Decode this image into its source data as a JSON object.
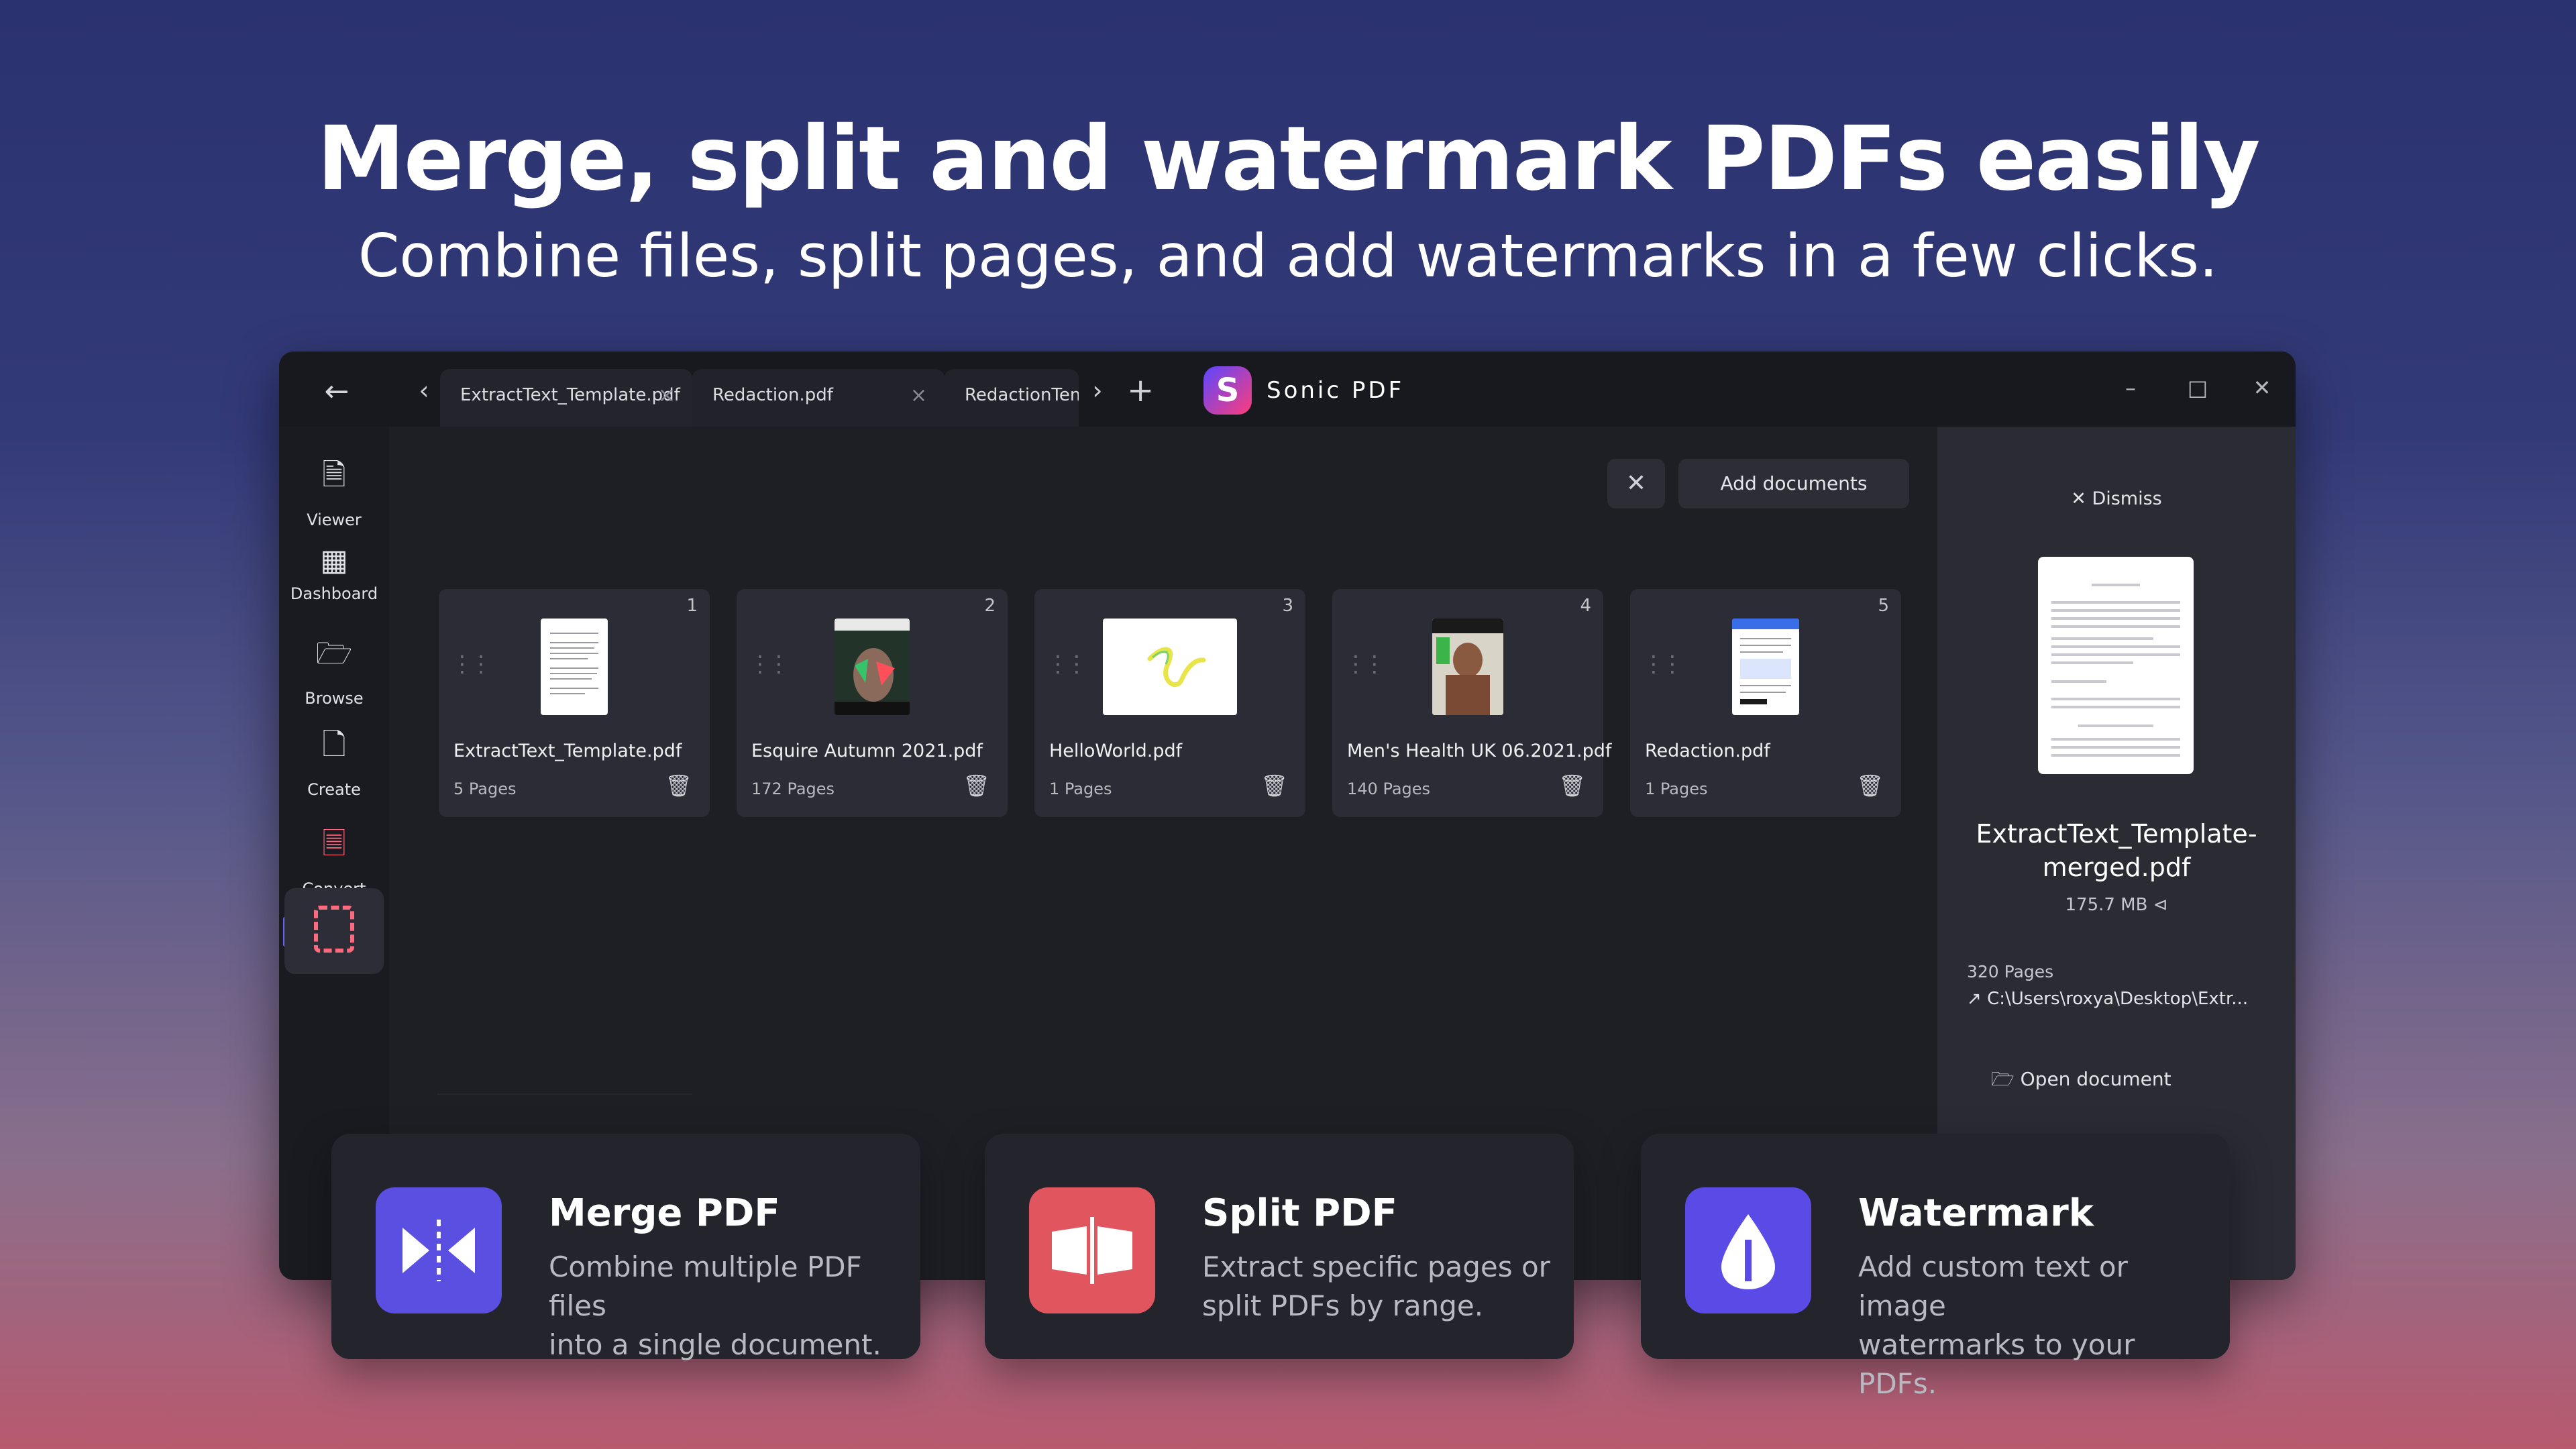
{
  "hero": {
    "title": "Merge, split and watermark PDFs easily",
    "subtitle": "Combine files, split pages, and add watermarks in a few clicks."
  },
  "window": {
    "tabs": [
      {
        "label": "ExtractText_Template.pdf"
      },
      {
        "label": "Redaction.pdf"
      },
      {
        "label": "RedactionTempla"
      }
    ],
    "app_name": "Sonic PDF",
    "logo_letter": "S"
  },
  "sidebar": {
    "items": [
      {
        "label": "Viewer",
        "icon": "viewer-icon"
      },
      {
        "label": "Dashboard",
        "icon": "dashboard-icon"
      },
      {
        "label": "Browse",
        "icon": "folder-icon"
      },
      {
        "label": "Create",
        "icon": "create-icon"
      },
      {
        "label": "Convert",
        "icon": "convert-icon"
      }
    ]
  },
  "toolbar": {
    "add_documents": "Add documents"
  },
  "documents": [
    {
      "index": "1",
      "name": "ExtractText_Template.pdf",
      "pages": "5 Pages"
    },
    {
      "index": "2",
      "name": "Esquire Autumn 2021.pdf",
      "pages": "172 Pages"
    },
    {
      "index": "3",
      "name": "HelloWorld.pdf",
      "pages": "1 Pages"
    },
    {
      "index": "4",
      "name": "Men's Health UK 06.2021.pdf",
      "pages": "140 Pages"
    },
    {
      "index": "5",
      "name": "Redaction.pdf",
      "pages": "1 Pages"
    }
  ],
  "panel": {
    "dismiss": "Dismiss",
    "filename_line1": "ExtractText_Template-",
    "filename_line2": "merged.pdf",
    "size": "175.7 MB",
    "pages": "320 Pages",
    "path": "C:\\Users\\roxya\\Desktop\\Extr...",
    "open_document": "Open document"
  },
  "features": [
    {
      "title": "Merge PDF",
      "desc_line1": "Combine multiple PDF files",
      "desc_line2": "into a single document.",
      "color": "#5a4fe0"
    },
    {
      "title": "Split PDF",
      "desc_line1": "Extract specific pages or",
      "desc_line2": "split PDFs by range.",
      "color": "#e0555e"
    },
    {
      "title": "Watermark",
      "desc_line1": "Add custom text or image",
      "desc_line2": "watermarks to your PDFs.",
      "color": "#5b4be6"
    }
  ],
  "colors": {
    "accent": "#6c63ff",
    "convert": "#ff6a7f"
  }
}
